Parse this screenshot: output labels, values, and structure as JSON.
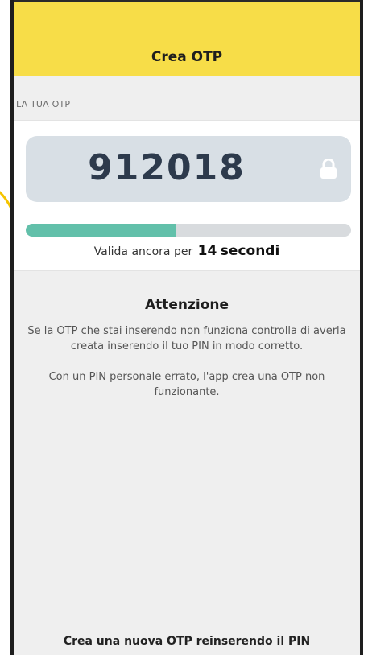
{
  "header": {
    "title": "Crea OTP"
  },
  "otp": {
    "section_label": "LA TUA OTP",
    "code": "912018",
    "lock_icon": "lock-icon",
    "progress_fraction": 0.46,
    "validity_prefix": "Valida ancora per",
    "seconds_left": "14",
    "seconds_unit": "secondi"
  },
  "warning": {
    "title": "Attenzione",
    "line1": "Se la OTP che stai inserendo non funziona controlla di averla creata inserendo il tuo PIN in modo corretto.",
    "line2": "Con un PIN personale errato, l'app crea una OTP non funzionante."
  },
  "footer": {
    "new_otp_label": "Crea una nuova OTP reinserendo il PIN"
  },
  "colors": {
    "header_bg": "#f7dd48",
    "otp_box_bg": "#d8dfe5",
    "progress_fill": "#62c0aa",
    "accent": "#f5c400"
  }
}
